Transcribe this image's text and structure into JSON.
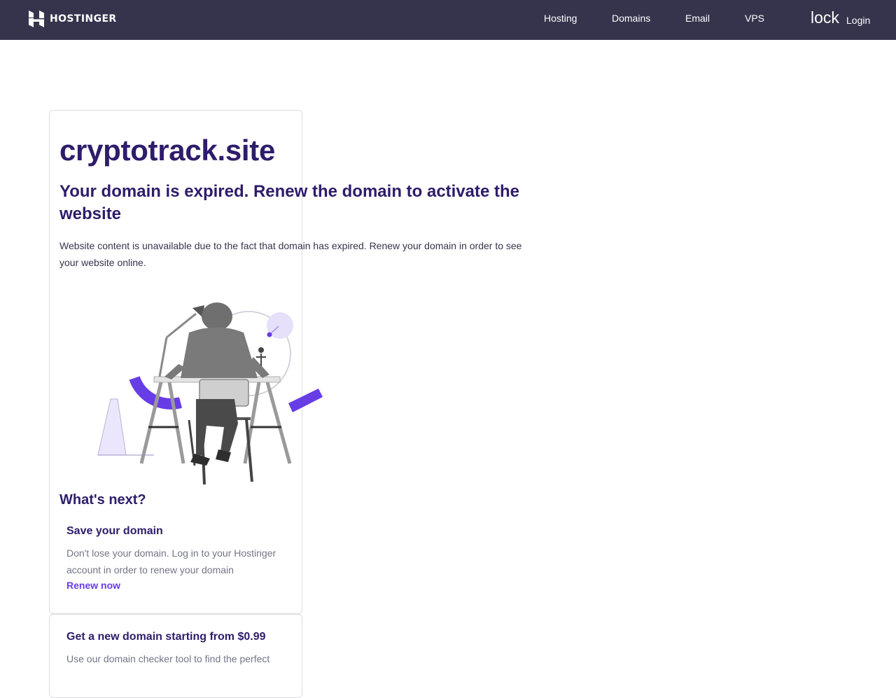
{
  "header": {
    "brand": "HOSTINGER",
    "nav": [
      "Hosting",
      "Domains",
      "Email",
      "VPS"
    ],
    "lock_text": "lock",
    "login_label": "Login"
  },
  "main": {
    "domain": "cryptotrack.site",
    "headline": "Your domain is expired. Renew the domain to activate the website",
    "description": "Website content is unavailable due to the fact that domain has expired. Renew your domain in order to see your website online.",
    "whats_next": "What's next?",
    "save": {
      "title": "Save your domain",
      "text": "Don't lose your domain. Log in to your Hostinger account in order to renew your domain",
      "link": "Renew now"
    },
    "new_domain": {
      "title": "Get a new domain starting from $0.99",
      "text": "Use our domain checker tool to find the perfect"
    }
  },
  "colors": {
    "header_bg": "#36344d",
    "heading": "#2f1c6a",
    "accent": "#673de6",
    "muted": "#727586"
  }
}
